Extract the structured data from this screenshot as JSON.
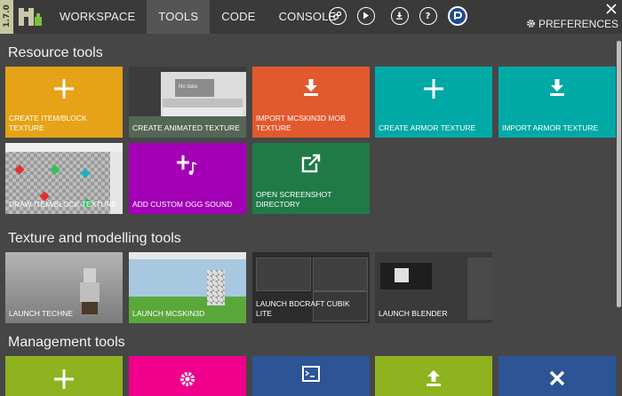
{
  "app": {
    "version": "1.7.0"
  },
  "nav": {
    "tabs": [
      {
        "label": "WORKSPACE"
      },
      {
        "label": "TOOLS"
      },
      {
        "label": "CODE"
      },
      {
        "label": "CONSOLE"
      }
    ]
  },
  "toolbar": {
    "preferences_label": "PREFERENCES",
    "icons": [
      "plugins-icon",
      "run-icon",
      "export-icon",
      "help-icon",
      "mcreator-icon"
    ]
  },
  "sections": {
    "resource": "Resource tools",
    "texture": "Texture and modelling tools",
    "management": "Management tools"
  },
  "resource_tiles": [
    {
      "label": "CREATE ITEM/BLOCK TEXTURE",
      "color": "#e6a317",
      "icon": "plus-icon"
    },
    {
      "label": "CREATE ANIMATED TEXTURE",
      "color": "#3c3c3c",
      "icon": "preview-image"
    },
    {
      "label": "IMPORT MCSKIN3D MOB TEXTURE",
      "color": "#e2592d",
      "icon": "download-icon"
    },
    {
      "label": "CREATE ARMOR TEXTURE",
      "color": "#00a9a5",
      "icon": "plus-icon"
    },
    {
      "label": "IMPORT ARMOR TEXTURE",
      "color": "#00a9a5",
      "icon": "download-icon"
    },
    {
      "label": "DRAW ITEM/BLOCK TEXTURE",
      "color": "#bbbbbb",
      "icon": "preview-image"
    },
    {
      "label": "ADD CUSTOM OGG SOUND",
      "color": "#a300b6",
      "icon": "music-plus-icon"
    },
    {
      "label": "OPEN SCREENSHOT DIRECTORY",
      "color": "#1f7a46",
      "icon": "open-external-icon"
    }
  ],
  "modelling_tiles": [
    {
      "label": "LAUNCH TECHNE",
      "color": "#8e8e8e"
    },
    {
      "label": "LAUNCH MCSKIN3D",
      "color": "#9fbfa0"
    },
    {
      "label": "LAUNCH BDCRAFT CUBIK LITE",
      "color": "#3a3a3a"
    },
    {
      "label": "LAUNCH BLENDER",
      "color": "#2e2e2e"
    }
  ],
  "management_tiles": [
    {
      "color": "#8fb31e",
      "icon": "plus-icon"
    },
    {
      "color": "#f0008a",
      "icon": "gear-icon"
    },
    {
      "color": "#2d5596",
      "icon": "terminal-icon"
    },
    {
      "color": "#8fb31e",
      "icon": "upload-icon"
    },
    {
      "color": "#2d5596",
      "icon": "close-icon"
    }
  ],
  "preview": {
    "no_data": "No data"
  }
}
